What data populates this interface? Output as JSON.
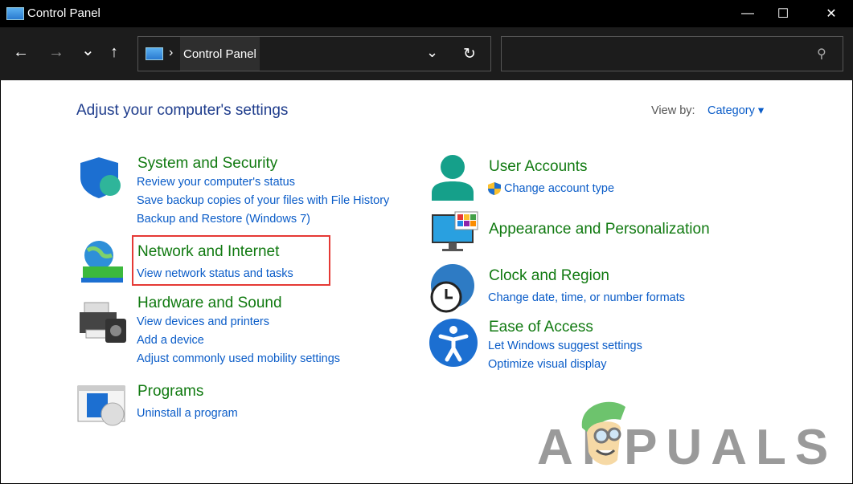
{
  "window": {
    "title": "Control Panel",
    "minimize": "—",
    "maximize": "☐",
    "close": "✕"
  },
  "toolbar": {
    "back": "←",
    "forward": "→",
    "recent": "⌄",
    "up": "↑",
    "breadcrumb_sep": "›",
    "breadcrumb": "Control Panel",
    "dropdown": "⌄",
    "refresh": "↻",
    "search_placeholder": "",
    "search_icon": "⚲"
  },
  "main": {
    "heading": "Adjust your computer's settings",
    "view_by_label": "View by:",
    "view_by_value": "Category",
    "left": [
      {
        "title": "System and Security",
        "links": [
          "Review your computer's status",
          "Save backup copies of your files with File History",
          "Backup and Restore (Windows 7)"
        ]
      },
      {
        "title": "Network and Internet",
        "links": [
          "View network status and tasks"
        ]
      },
      {
        "title": "Hardware and Sound",
        "links": [
          "View devices and printers",
          "Add a device",
          "Adjust commonly used mobility settings"
        ]
      },
      {
        "title": "Programs",
        "links": [
          "Uninstall a program"
        ]
      }
    ],
    "right": [
      {
        "title": "User Accounts",
        "links": [
          "Change account type"
        ]
      },
      {
        "title": "Appearance and Personalization",
        "links": []
      },
      {
        "title": "Clock and Region",
        "links": [
          "Change date, time, or number formats"
        ]
      },
      {
        "title": "Ease of Access",
        "links": [
          "Let Windows suggest settings",
          "Optimize visual display"
        ]
      }
    ]
  },
  "watermark": "APPUALS",
  "colors": {
    "highlight": "#e53935",
    "title": "#117a11",
    "link": "#0a5cc8"
  }
}
